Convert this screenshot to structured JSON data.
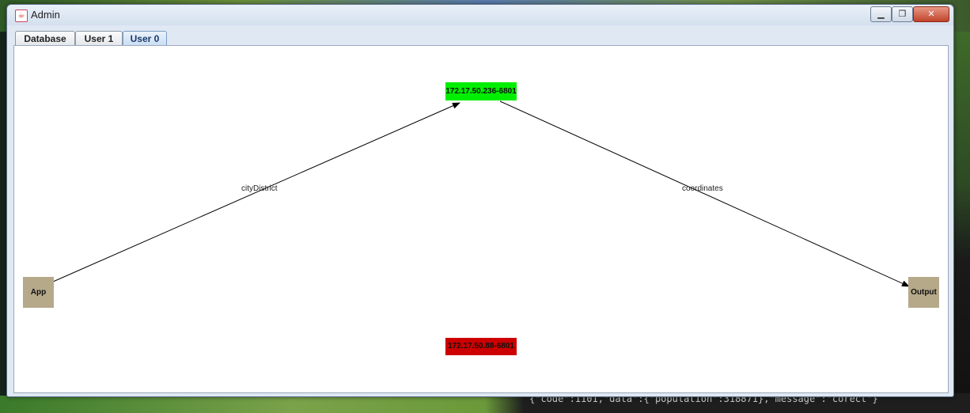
{
  "window": {
    "title": "Admin",
    "icon": "java-cup-icon"
  },
  "title_buttons": {
    "minimize": "▁",
    "maximize": "❐",
    "close": "✕"
  },
  "tabs": [
    {
      "label": "Database",
      "active": false
    },
    {
      "label": "User 1",
      "active": false
    },
    {
      "label": "User 0",
      "active": true
    }
  ],
  "graph": {
    "nodes": {
      "server_active": {
        "label": "172.17.50.236-6801",
        "color": "#00ee00"
      },
      "server_inactive": {
        "label": "172.17.50.88-6801",
        "color": "#cc0000"
      },
      "app": {
        "label": "App",
        "color": "#b5a98a"
      },
      "output": {
        "label": "Output",
        "color": "#b5a98a"
      }
    },
    "edges": [
      {
        "from": "app",
        "to": "server_active",
        "label": "cityDistrict"
      },
      {
        "from": "server_active",
        "to": "output",
        "label": "coordinates"
      }
    ]
  },
  "background": {
    "console_text": "{\"code\":1101,\"data\":{\"population\":318871},\"message\":\"corect\"}"
  }
}
